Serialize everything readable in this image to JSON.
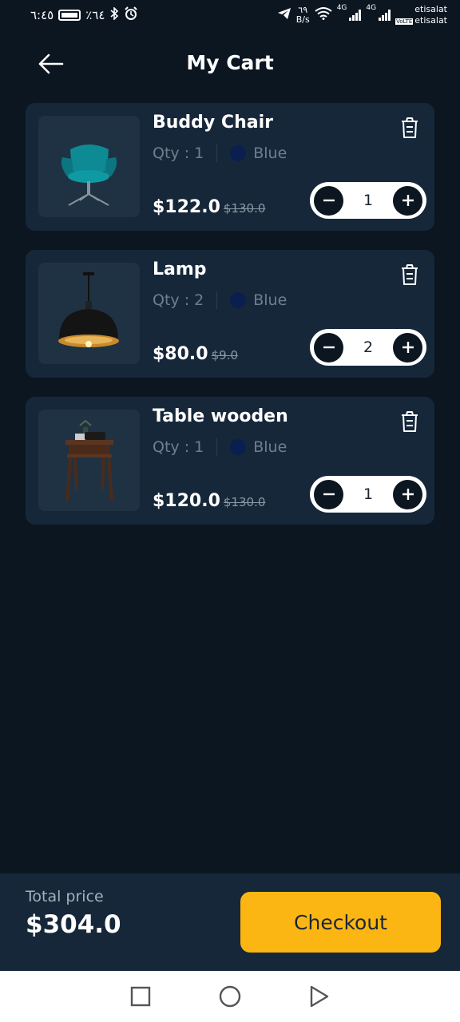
{
  "status_bar": {
    "time": "٦:٤٥",
    "battery": "٪٦٤",
    "speed_value": "٦٩",
    "speed_unit": "B/s",
    "network_1": "4G",
    "network_2": "4G",
    "carrier_1": "etisalat",
    "carrier_2": "etisalat",
    "volte": "VoLTE"
  },
  "header": {
    "title": "My Cart",
    "back_icon": "arrow-left-icon"
  },
  "cart": {
    "items": [
      {
        "name": "Buddy Chair",
        "qty_label": "Qty : 1",
        "color_name": "Blue",
        "color_hex": "#0a1f4f",
        "price": "$122.0",
        "old_price": "$130.0",
        "quantity": "1",
        "image": "teal-armchair"
      },
      {
        "name": "Lamp",
        "qty_label": "Qty : 2",
        "color_name": "Blue",
        "color_hex": "#0a1f4f",
        "price": "$80.0",
        "old_price": "$9.0",
        "quantity": "2",
        "image": "pendant-lamp"
      },
      {
        "name": "Table wooden",
        "qty_label": "Qty : 1",
        "color_name": "Blue",
        "color_hex": "#0a1f4f",
        "price": "$120.0",
        "old_price": "$130.0",
        "quantity": "1",
        "image": "wooden-side-table"
      }
    ]
  },
  "footer": {
    "total_label": "Total price",
    "total_value": "$304.0",
    "checkout_label": "Checkout"
  },
  "theme": {
    "background": "#0b1621",
    "card": "#16273a",
    "accent": "#fbb613"
  }
}
